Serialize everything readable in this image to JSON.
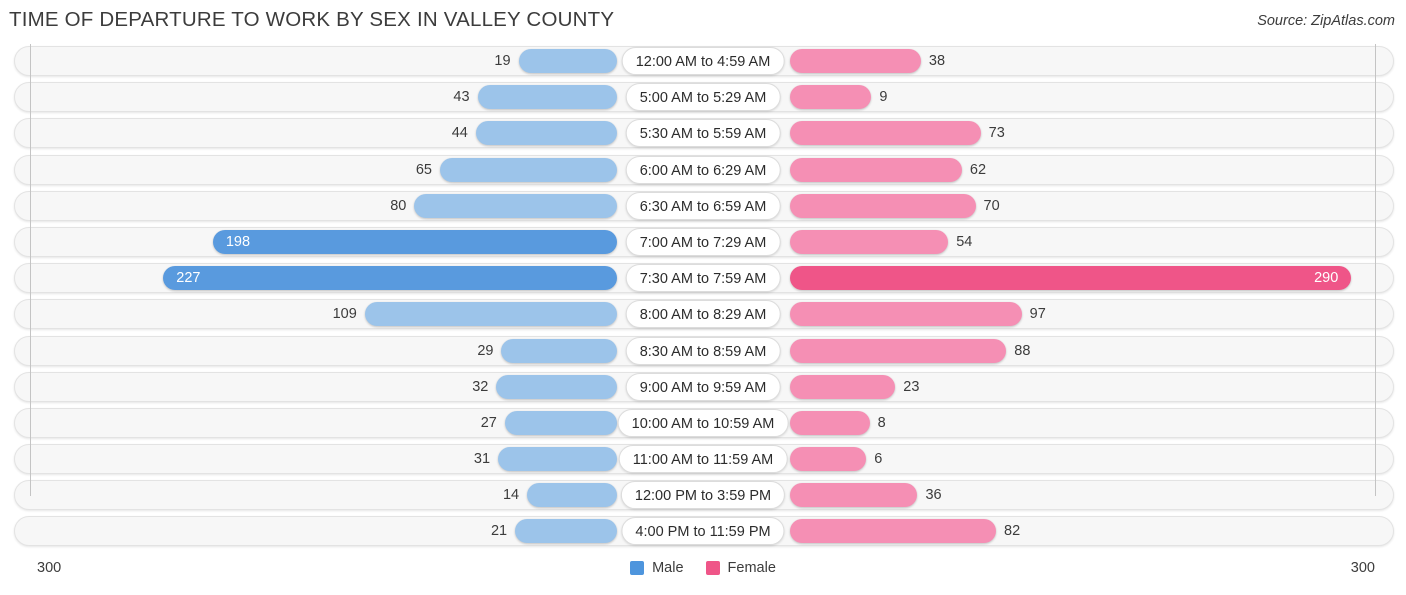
{
  "header": {
    "title": "TIME OF DEPARTURE TO WORK BY SEX IN VALLEY COUNTY",
    "source": "Source: ZipAtlas.com"
  },
  "footer": {
    "tick_left": "300",
    "tick_right": "300",
    "legend": [
      {
        "label": "Male",
        "color": "#4e95dd"
      },
      {
        "label": "Female",
        "color": "#ef5588"
      }
    ]
  },
  "chart_data": {
    "type": "bar",
    "orientation": "horizontal-diverging",
    "title": "TIME OF DEPARTURE TO WORK BY SEX IN VALLEY COUNTY",
    "xlabel": "",
    "ylabel": "",
    "axis_max": 300,
    "axis_tick_labels": [
      "300",
      "300"
    ],
    "grid": false,
    "legend_position": "bottom-center",
    "categories": [
      "12:00 AM to 4:59 AM",
      "5:00 AM to 5:29 AM",
      "5:30 AM to 5:59 AM",
      "6:00 AM to 6:29 AM",
      "6:30 AM to 6:59 AM",
      "7:00 AM to 7:29 AM",
      "7:30 AM to 7:59 AM",
      "8:00 AM to 8:29 AM",
      "8:30 AM to 8:59 AM",
      "9:00 AM to 9:59 AM",
      "10:00 AM to 10:59 AM",
      "11:00 AM to 11:59 AM",
      "12:00 PM to 3:59 PM",
      "4:00 PM to 11:59 PM"
    ],
    "series": [
      {
        "name": "Male",
        "color": "#9cc4ea",
        "highlight_color": "#599ade",
        "values": [
          19,
          43,
          44,
          65,
          80,
          198,
          227,
          109,
          29,
          32,
          27,
          31,
          14,
          21
        ]
      },
      {
        "name": "Female",
        "color": "#f58fb4",
        "highlight_color": "#ef5588",
        "values": [
          38,
          9,
          73,
          62,
          70,
          54,
          290,
          97,
          88,
          23,
          8,
          6,
          36,
          82
        ]
      }
    ]
  }
}
